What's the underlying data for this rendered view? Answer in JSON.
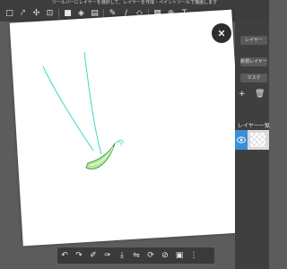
{
  "hint_text": "ツールバーにレイヤーを選択して、レイヤーを作成・ペイントツールで描画します",
  "toolbar": {
    "tools": [
      {
        "name": "select-rect-icon",
        "glyph": "□"
      },
      {
        "name": "select-freehand-icon",
        "glyph": "⤤"
      },
      {
        "name": "move-icon",
        "glyph": "✣"
      },
      {
        "name": "transform-icon",
        "glyph": "⊡"
      },
      {
        "name": "color-fill-icon",
        "glyph": "■"
      },
      {
        "name": "bucket-icon",
        "glyph": "◈"
      },
      {
        "name": "gradient-icon",
        "glyph": "▤"
      },
      {
        "name": "pen-icon",
        "glyph": "✎"
      },
      {
        "name": "brush-icon",
        "glyph": "/"
      },
      {
        "name": "eraser-icon",
        "glyph": "◇"
      },
      {
        "name": "frame-icon",
        "glyph": "▦"
      },
      {
        "name": "zoom-select-icon",
        "glyph": "⊕"
      },
      {
        "name": "text-icon",
        "glyph": "T"
      }
    ]
  },
  "panel": {
    "top_label": "レイヤー",
    "btn1": "新規レイヤー",
    "btn2": "マスク",
    "layer_header": "レイヤー一覧",
    "layer_name": "レイヤー1"
  },
  "bottom_tools": [
    {
      "name": "undo-icon",
      "glyph": "↶"
    },
    {
      "name": "redo-icon",
      "glyph": "↷"
    },
    {
      "name": "brush-tool-icon",
      "glyph": "✐"
    },
    {
      "name": "eyedropper-icon",
      "glyph": "✑"
    },
    {
      "name": "save-icon",
      "glyph": "⤓"
    },
    {
      "name": "flip-icon",
      "glyph": "⇋"
    },
    {
      "name": "rotate-icon",
      "glyph": "⟳"
    },
    {
      "name": "edit-icon",
      "glyph": "⊘"
    },
    {
      "name": "image-icon",
      "glyph": "▣"
    },
    {
      "name": "more-icon",
      "glyph": "⋮"
    }
  ],
  "colors": {
    "stroke": "#3fd9c4",
    "leaf_fill": "#b5e9a0",
    "accent": "#3a8fd6"
  }
}
